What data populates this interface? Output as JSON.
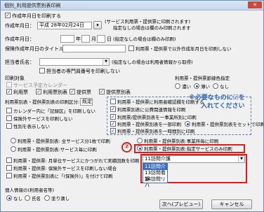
{
  "window": {
    "title": "個別_利用提供票別表印刷",
    "close": "✕"
  },
  "print_date": {
    "checkbox_label": "作成年月日を印刷する",
    "label": "作成年月日：",
    "value": "平成 28年02月24日",
    "note1": "(サービス利用票・提供票に印刷されます)",
    "note2": "指定なしの場合は欄のみ印刷されます"
  },
  "plan_date": {
    "label": "作成年月日：",
    "year_label": "年",
    "month_label": "月",
    "day_label": "日",
    "note": "(指定なしの場合は欄のみ印刷)"
  },
  "sub_title": {
    "label": "保険作成年月日のタイトル:",
    "checkbox_label": "利用票・提供票で以外作成年月日を印刷しない"
  },
  "care_manager": {
    "label": "担当者氏名：",
    "note": "(指定なしの場合は利用者情報から取得)",
    "checkbox_label": "担当者の専門員番号を印刷しない"
  },
  "print_target": {
    "heading": "印刷対象",
    "service_calendar": "サービス予定カレンダー",
    "items": [
      "利用票",
      "利用票別表",
      "提供票",
      "提供票別表"
    ],
    "checked": [
      true,
      true,
      true,
      true
    ]
  },
  "period": {
    "label": "利用票別表・提供票別表の印刷区分:",
    "select_value": "既定"
  },
  "options_left": [
    "カレンダー内に「記録区」を印刷しない",
    "保険外サービスを印刷しない",
    "性別を表示しない"
  ],
  "options_right": [
    "利用票・提供票に利用者確認欄を印刷する",
    "利用票別表に公費関連情報を印刷",
    "利用票/提供票別表を一事業所別に印刷",
    "利用票・提供票別表を一部印刷",
    "利用票・提供票別表を一時間別に印刷"
  ],
  "options_right_checked": [
    false,
    true,
    true,
    true,
    true
  ],
  "fill_color": {
    "heading": "利用票・提供票罫線色指定",
    "options": [
      "濃い",
      "薄い",
      "なし"
    ],
    "selected": 1
  },
  "note_box": {
    "line1": "※必要なものに☑を",
    "line2": "入れてください"
  },
  "radio_rows": {
    "r1_left": "利用票・提供票別表: 全サービス分1枚で印刷",
    "r1_mid": "利用票・提供票別表:事業所毎に印刷",
    "r2_left": "利用票・提供票別表:サービス毎に印刷",
    "r2_mid": "利用票・提供票別表:指定サービスのみ印刷",
    "r_right1": "利用票一部のみ印刷",
    "r_right2": "利用票・提供票別表をセットで印刷"
  },
  "annotation_num": "②",
  "service_select": {
    "value": "11訪問介護",
    "options": [
      "11訪問介護",
      "13訪問看護",
      "14訪問リハ",
      "17用具貸与"
    ],
    "highlighted": 0
  },
  "bottom_options": {
    "line1": "利用票・提供票: 月単位サービスにかつがれて実績回数を印刷",
    "line2": "利用票・提供票: 保険外サービスを印刷しない場合",
    "line3": "利用票・提供票別表に「(保険外)」を付けて印刷"
  },
  "personal_info": {
    "heading": "個人情報の(利用者名等)",
    "options": [
      "なし",
      "氏名",
      "塗り潰し"
    ],
    "selected": 0
  },
  "buttons": {
    "next": "次へ(プレビュー)",
    "cancel": "キャンセル"
  },
  "colors": {
    "accent": "#d62020",
    "note_blue": "#2b63b0",
    "highlight": "#3a6fc4"
  }
}
